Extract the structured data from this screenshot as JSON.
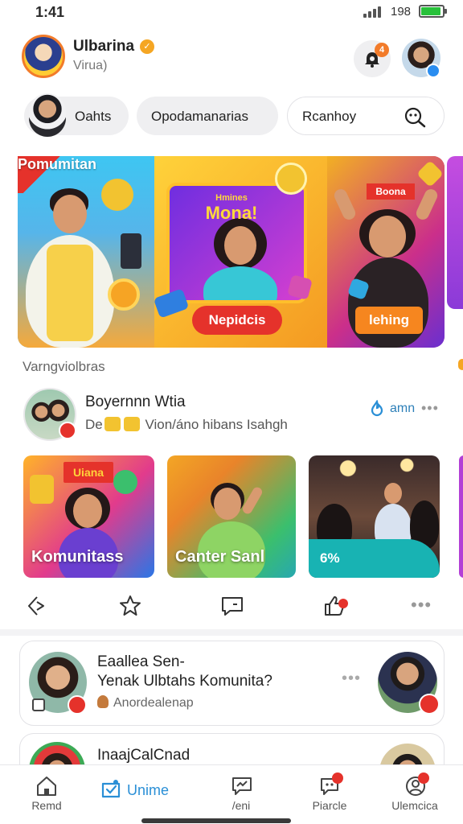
{
  "status_bar": {
    "time": "1:41",
    "battery_text": "198"
  },
  "profile": {
    "name": "Ulbarina",
    "subtitle": "Virua)",
    "notification_count": "4"
  },
  "chips": [
    {
      "label": "Oahts"
    },
    {
      "label": "Opodamanarias"
    },
    {
      "label": "Rcanhoy"
    }
  ],
  "banner": {
    "panel_1_label": "Pomumitan",
    "panel_2_headline_small": "Hmines",
    "panel_2_headline": "Mona!",
    "panel_2_button": "Nepidcis",
    "panel_3_badge": "Boona",
    "panel_3_button": "lehing"
  },
  "section": {
    "title": "Varngviolbras"
  },
  "post": {
    "title": "Boyernnn Wtia",
    "subtitle_prefix": "De",
    "subtitle_text": "Vion/áno hibans Isahgh",
    "time": "amn",
    "thumbnails": [
      {
        "label": "Komunitass",
        "badge": "Uiana"
      },
      {
        "label": "Canter Sanl"
      },
      {
        "label": "6%"
      }
    ]
  },
  "cards": [
    {
      "title_line_1": "Eaallea Sen-",
      "title_line_2": "Yenak Ulbtahs Komunita?",
      "meta": "Anordealenap"
    },
    {
      "title_line_1": "InaajCalCnad"
    }
  ],
  "bottom_nav": [
    {
      "label": "Remd",
      "icon": "home-icon"
    },
    {
      "label": "Unime",
      "icon": "community-icon",
      "active": true
    },
    {
      "label": "/eni",
      "icon": "chat-icon"
    },
    {
      "label": "Piarcle",
      "icon": "message-icon"
    },
    {
      "label": "Ulemcica",
      "icon": "profile-icon"
    }
  ],
  "colors": {
    "accent": "#2a8fd6",
    "orange": "#f27b2a",
    "red": "#e5322b",
    "battery": "#28c13a"
  }
}
